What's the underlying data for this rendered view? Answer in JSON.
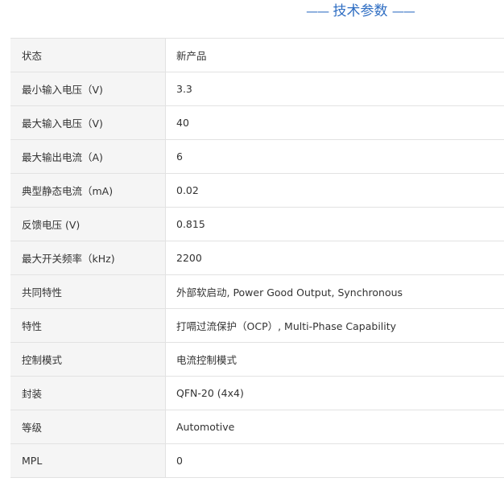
{
  "section": {
    "title": "技术参数",
    "dash_left": "——",
    "dash_right": "——"
  },
  "params": [
    {
      "name": "状态",
      "value": "新产品"
    },
    {
      "name": "最小输入电压（V)",
      "value": "3.3"
    },
    {
      "name": "最大输入电压（V)",
      "value": "40"
    },
    {
      "name": "最大输出电流（A)",
      "value": "6"
    },
    {
      "name": "典型静态电流（mA)",
      "value": "0.02"
    },
    {
      "name": "反馈电压 (V)",
      "value": "0.815"
    },
    {
      "name": "最大开关频率（kHz)",
      "value": "2200"
    },
    {
      "name": "共同特性",
      "value": "外部软启动, Power Good Output, Synchronous"
    },
    {
      "name": "特性",
      "value": "打嗝过流保护（OCP）, Multi-Phase Capability"
    },
    {
      "name": "控制模式",
      "value": "电流控制模式"
    },
    {
      "name": "封装",
      "value": "QFN-20 (4x4)"
    },
    {
      "name": "等级",
      "value": "Automotive"
    },
    {
      "name": "MPL",
      "value": "0"
    }
  ]
}
